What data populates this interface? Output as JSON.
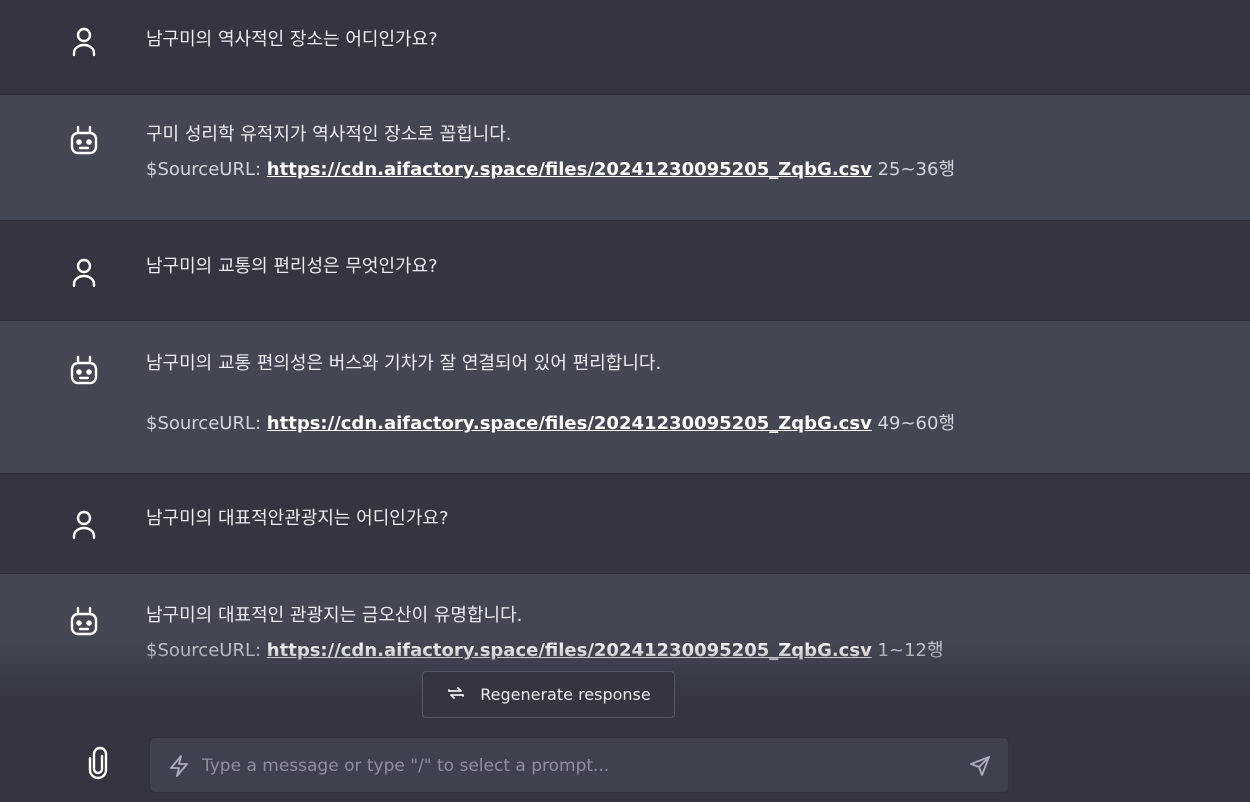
{
  "messages": [
    {
      "role": "user",
      "icon": "user-icon",
      "text": "남구미의 역사적인 장소는 어디인가요?"
    },
    {
      "role": "bot",
      "icon": "robot-icon",
      "text": "구미 성리학 유적지가 역사적인 장소로 꼽힙니다.",
      "source": {
        "prefix": "$SourceURL:",
        "url": "https://cdn.aifactory.space/files/20241230095205_ZqbG.csv",
        "suffix": "25~36행"
      }
    },
    {
      "role": "user",
      "icon": "user-icon",
      "text": "남구미의 교통의 편리성은 무엇인가요?"
    },
    {
      "role": "bot",
      "icon": "robot-icon",
      "text": "남구미의 교통 편의성은 버스와 기차가 잘 연결되어 있어 편리합니다.",
      "source": {
        "prefix": "$SourceURL:",
        "url": "https://cdn.aifactory.space/files/20241230095205_ZqbG.csv",
        "suffix": "49~60행"
      }
    },
    {
      "role": "user",
      "icon": "user-icon",
      "text": "남구미의 대표적안관광지는 어디인가요?"
    },
    {
      "role": "bot",
      "icon": "robot-icon",
      "text": "남구미의 대표적인 관광지는 금오산이 유명합니다.",
      "source": {
        "prefix": "$SourceURL:",
        "url": "https://cdn.aifactory.space/files/20241230095205_ZqbG.csv",
        "suffix": "1~12행"
      }
    }
  ],
  "regenerate": {
    "label": "Regenerate response",
    "icon": "refresh-icon"
  },
  "composer": {
    "placeholder": "Type a message or type \"/\" to select a prompt...",
    "value": "",
    "attach_icon": "paperclip-icon",
    "prompt_icon": "bolt-icon",
    "send_icon": "send-icon"
  },
  "colors": {
    "user_row_bg": "#343541",
    "bot_row_bg": "#444654",
    "input_bg": "#40414f",
    "text": "#ececf1",
    "placeholder": "#8e8ea0"
  }
}
